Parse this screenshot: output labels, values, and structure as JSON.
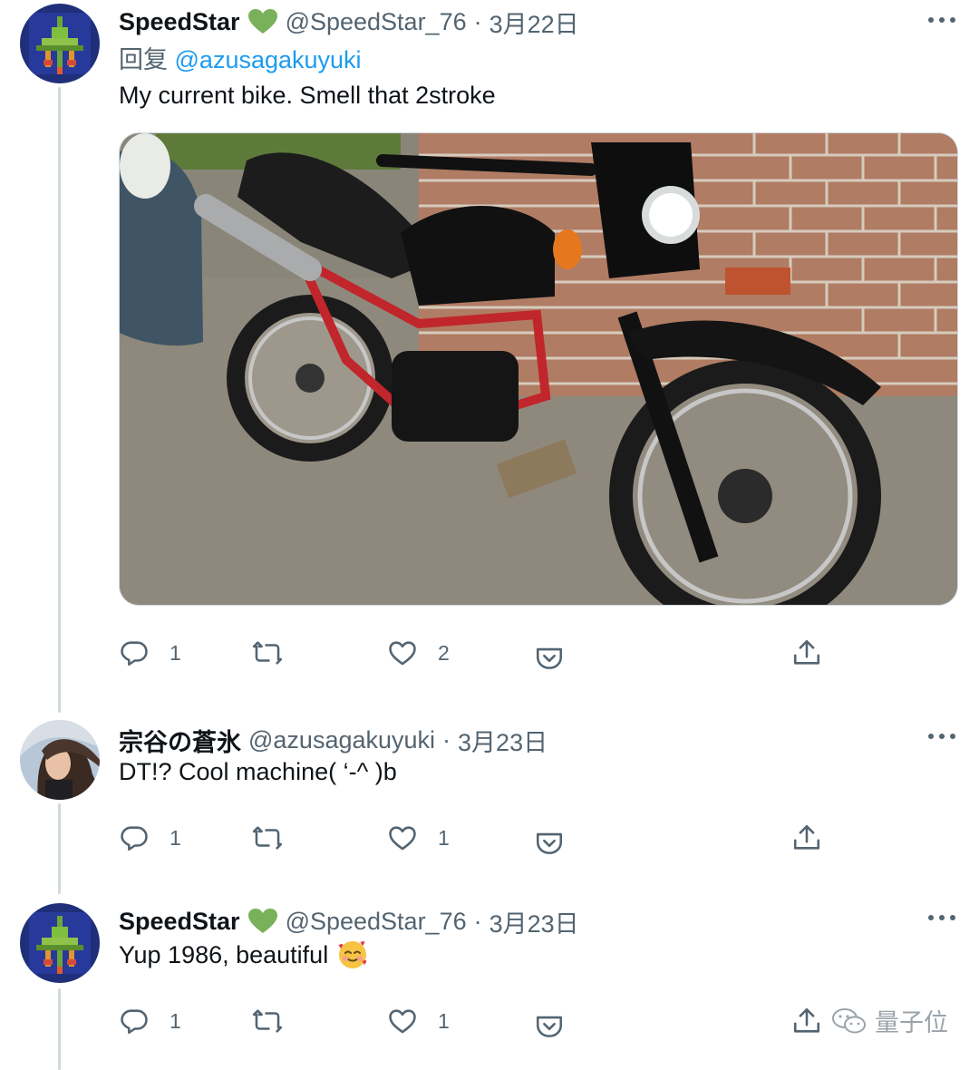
{
  "tweets": [
    {
      "display_name": "SpeedStar",
      "verified_emoji": "heart-icon",
      "handle": "@SpeedStar_76",
      "separator": "·",
      "date": "3月22日",
      "reply_prefix": "回复",
      "reply_to": "@azusagakuyuki",
      "text": "My current bike. Smell that 2stroke",
      "has_media": true,
      "reply_count": "1",
      "retweet_count": "",
      "like_count": "2"
    },
    {
      "display_name": "宗谷の蒼氷",
      "handle": "@azusagakuyuki",
      "separator": "·",
      "date": "3月23日",
      "text": "DT!? Cool machine( ‘-^ )b",
      "reply_count": "1",
      "retweet_count": "",
      "like_count": "1"
    },
    {
      "display_name": "SpeedStar",
      "verified_emoji": "heart-icon",
      "handle": "@SpeedStar_76",
      "separator": "·",
      "date": "3月23日",
      "text": "Yup 1986, beautiful",
      "text_emoji": "smiling-face-with-hearts-icon",
      "reply_count": "1",
      "retweet_count": "",
      "like_count": "1"
    }
  ],
  "watermark": {
    "text": "量子位",
    "icon": "wechat-icon"
  },
  "colors": {
    "text_primary": "#0f1419",
    "text_secondary": "#536471",
    "link": "#1d9bf0",
    "thread_line": "#cfd9de",
    "heart_green": "#78b159"
  }
}
